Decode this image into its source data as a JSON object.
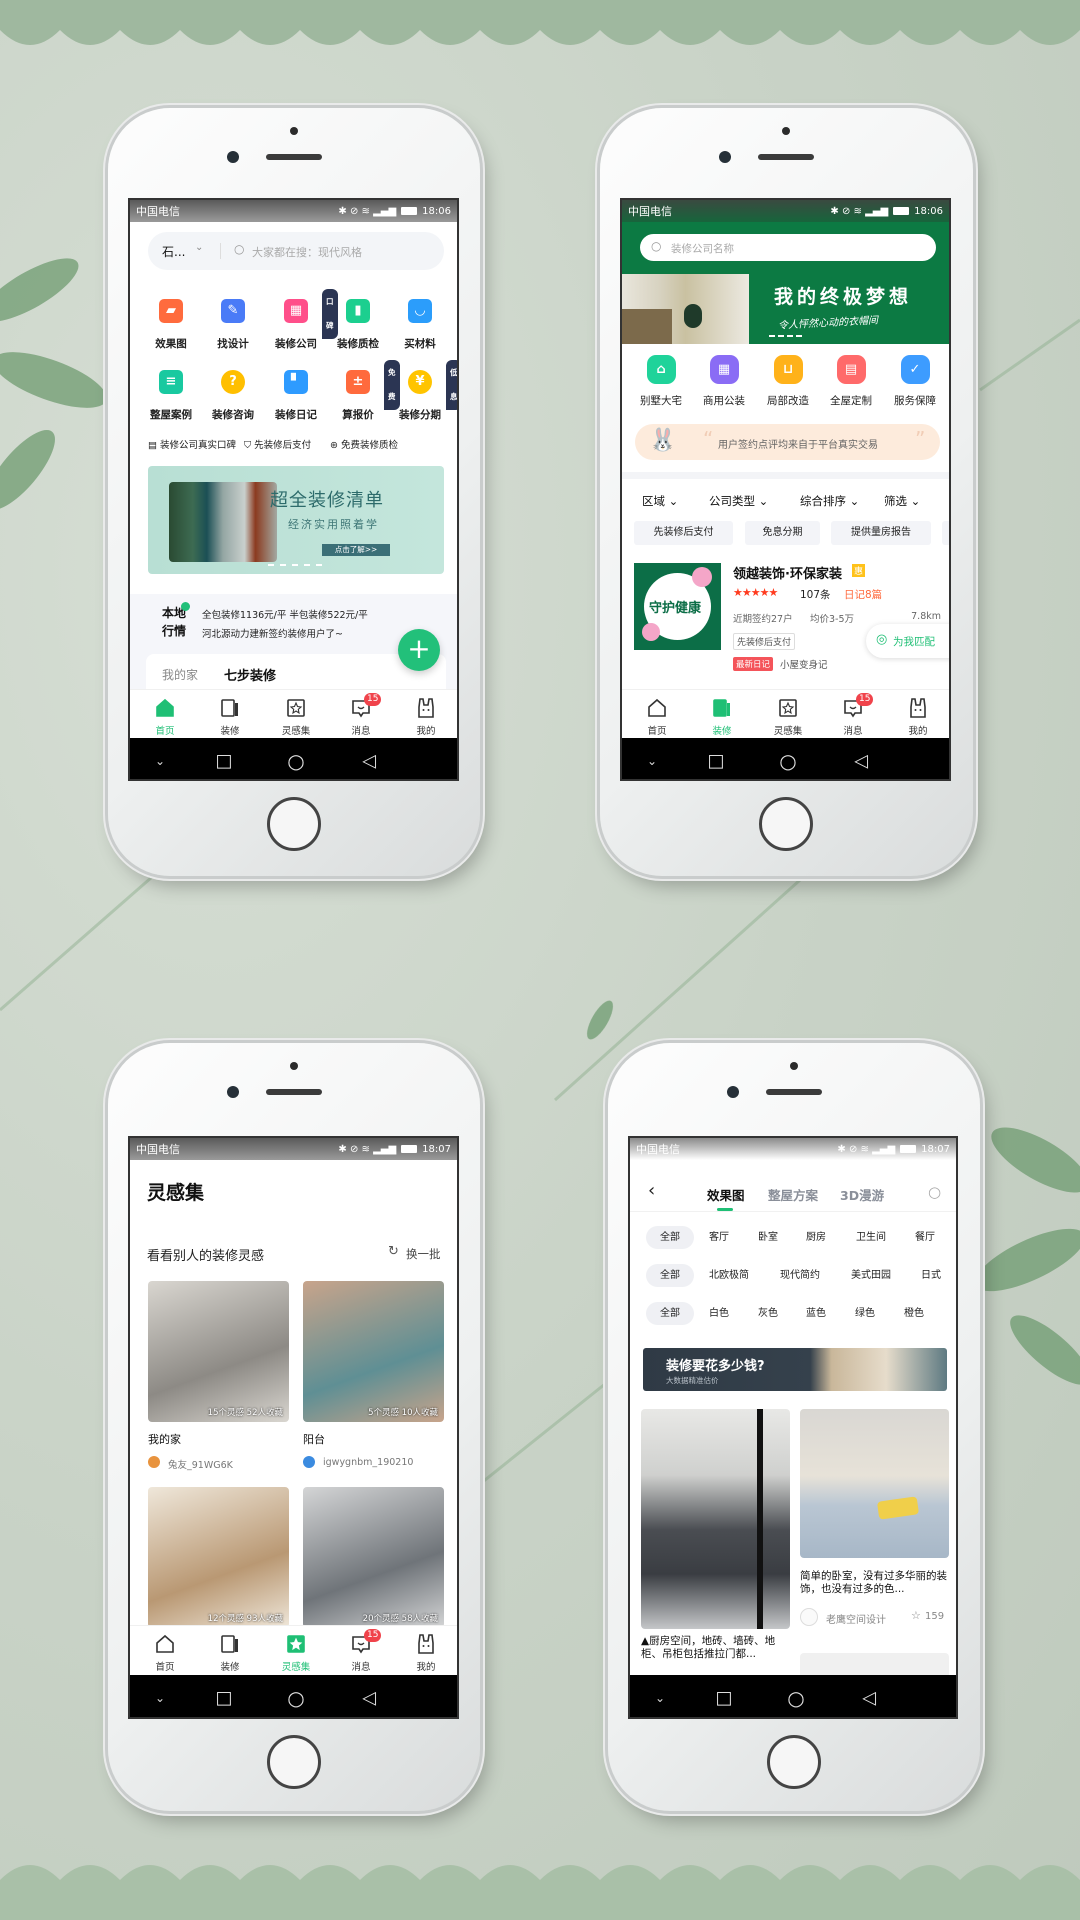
{
  "status_bar": {
    "carrier": "中国电信",
    "network": "2G"
  },
  "tabbar": {
    "items": [
      {
        "label": "首页",
        "icon": "home-icon"
      },
      {
        "label": "装修",
        "icon": "decoration-icon"
      },
      {
        "label": "灵感集",
        "icon": "star-square-icon"
      },
      {
        "label": "消息",
        "icon": "message-icon",
        "badge": "15"
      },
      {
        "label": "我的",
        "icon": "rabbit-profile-icon"
      }
    ],
    "accent": "#1fbf75"
  },
  "home": {
    "time": "18:06",
    "active_tab": 0,
    "location": "石...",
    "search_placeholder": "大家都在搜：现代风格",
    "grid": [
      {
        "label": "效果图",
        "icon": "image-icon",
        "glyph": "▰",
        "color": "#ff6b3d"
      },
      {
        "label": "找设计",
        "icon": "pen-icon",
        "glyph": "✎",
        "color": "#4a7bf7"
      },
      {
        "label": "装修公司",
        "icon": "building-icon",
        "glyph": "▦",
        "color": "#ff4f8a",
        "badge": "口碑"
      },
      {
        "label": "装修质检",
        "icon": "inspect-icon",
        "glyph": "▮",
        "color": "#1ccf8f"
      },
      {
        "label": "买材料",
        "icon": "bag-icon",
        "glyph": "◡",
        "color": "#2b9dfb"
      },
      {
        "label": "整屋案例",
        "icon": "document-icon",
        "glyph": "≡",
        "color": "#19c9a0"
      },
      {
        "label": "装修咨询",
        "icon": "question-icon",
        "glyph": "?",
        "color": "#ffbf00"
      },
      {
        "label": "装修日记",
        "icon": "bookmark-icon",
        "glyph": "▘",
        "color": "#2e9bff"
      },
      {
        "label": "算报价",
        "icon": "calculator-icon",
        "glyph": "±",
        "color": "#ff6a3d",
        "badge": "免费"
      },
      {
        "label": "装修分期",
        "icon": "yen-icon",
        "glyph": "¥",
        "color": "#ffc400",
        "badge": "低息"
      }
    ],
    "features": [
      {
        "label": "装修公司真实口碑",
        "icon": "note-icon"
      },
      {
        "label": "先装修后支付",
        "icon": "shield-check-icon"
      },
      {
        "label": "免费装修质检",
        "icon": "yen-circle-icon"
      }
    ],
    "banner": {
      "title": "超全装修清单",
      "subtitle": "经济实用照着学",
      "button": "点击了解>>"
    },
    "market": {
      "label_1": "本地",
      "label_2": "行情",
      "line_1": "全包装修1136元/平 半包装修522元/平",
      "line_2": "河北源动力建新签约装修用户了~"
    },
    "card_tabs": [
      "我的家",
      "七步装修"
    ]
  },
  "company": {
    "time": "18:06",
    "active_tab": 1,
    "search_placeholder": "装修公司名称",
    "banner": {
      "title": "我的终极梦想",
      "subtitle": "令人怦然心动的衣帽间"
    },
    "categories": [
      {
        "label": "别墅大宅",
        "color": "#1fd39a",
        "glyph": "⌂"
      },
      {
        "label": "商用公装",
        "color": "#8a6cf5",
        "glyph": "▦"
      },
      {
        "label": "局部改造",
        "color": "#ffb21a",
        "glyph": "⊔"
      },
      {
        "label": "全屋定制",
        "color": "#ff6a6a",
        "glyph": "▤"
      },
      {
        "label": "服务保障",
        "color": "#3d9cff",
        "glyph": "✓"
      }
    ],
    "notice": "用户签约点评均来自于平台真实交易",
    "filters": [
      "区域",
      "公司类型",
      "综合排序",
      "筛选"
    ],
    "tags": [
      "先装修后支付",
      "免息分期",
      "提供量房报告"
    ],
    "listing": {
      "name": "领越装饰·环保家装",
      "badge": "惠",
      "rating": 5,
      "reviews": "107条",
      "diary": "日记8篇",
      "signed": "近期签约27户",
      "price": "均价3-5万",
      "distance": "7.8km",
      "tag": "先装修后支付",
      "latest_label": "最新日记",
      "latest": "小屋变身记",
      "logo_text": "守护健康"
    },
    "match_button": "为我匹配"
  },
  "inspiration": {
    "time": "18:07",
    "active_tab": 2,
    "title": "灵感集",
    "section": "看看别人的装修灵感",
    "refresh": "换一批",
    "cards": [
      {
        "stats": "15个灵感  52人收藏",
        "title": "我的家",
        "user": "兔友_91WG6K",
        "tone": [
          "#8d8a85",
          "#d9d6d0"
        ]
      },
      {
        "stats": "5个灵感  10人收藏",
        "title": "阳台",
        "user": "igwygnbm_190210",
        "tone": [
          "#5f8f94",
          "#c8a48b"
        ]
      },
      {
        "stats": "12个灵感  93人收藏",
        "tone": [
          "#b99873",
          "#efe7da"
        ]
      },
      {
        "stats": "20个灵感  58人收藏",
        "tone": [
          "#6f7479",
          "#d4d5d6"
        ]
      }
    ]
  },
  "gallery": {
    "time": "18:07",
    "tabs": [
      "效果图",
      "整屋方案",
      "3D漫游"
    ],
    "rows": [
      [
        "全部",
        "客厅",
        "卧室",
        "厨房",
        "卫生间",
        "餐厅"
      ],
      [
        "全部",
        "北欧极简",
        "现代简约",
        "美式田园",
        "日式"
      ],
      [
        "全部",
        "白色",
        "灰色",
        "蓝色",
        "绿色",
        "橙色"
      ]
    ],
    "ad": {
      "title": "装修要花多少钱?",
      "subtitle": "大数据精准估价"
    },
    "cards": [
      {
        "caption": "▲厨房空间，地砖、墙砖、地柜、吊柜包括推拉门都..."
      },
      {
        "caption": "简单的卧室，没有过多华丽的装饰，也没有过多的色...",
        "author": "老鹰空间设计",
        "likes": "159"
      }
    ]
  }
}
